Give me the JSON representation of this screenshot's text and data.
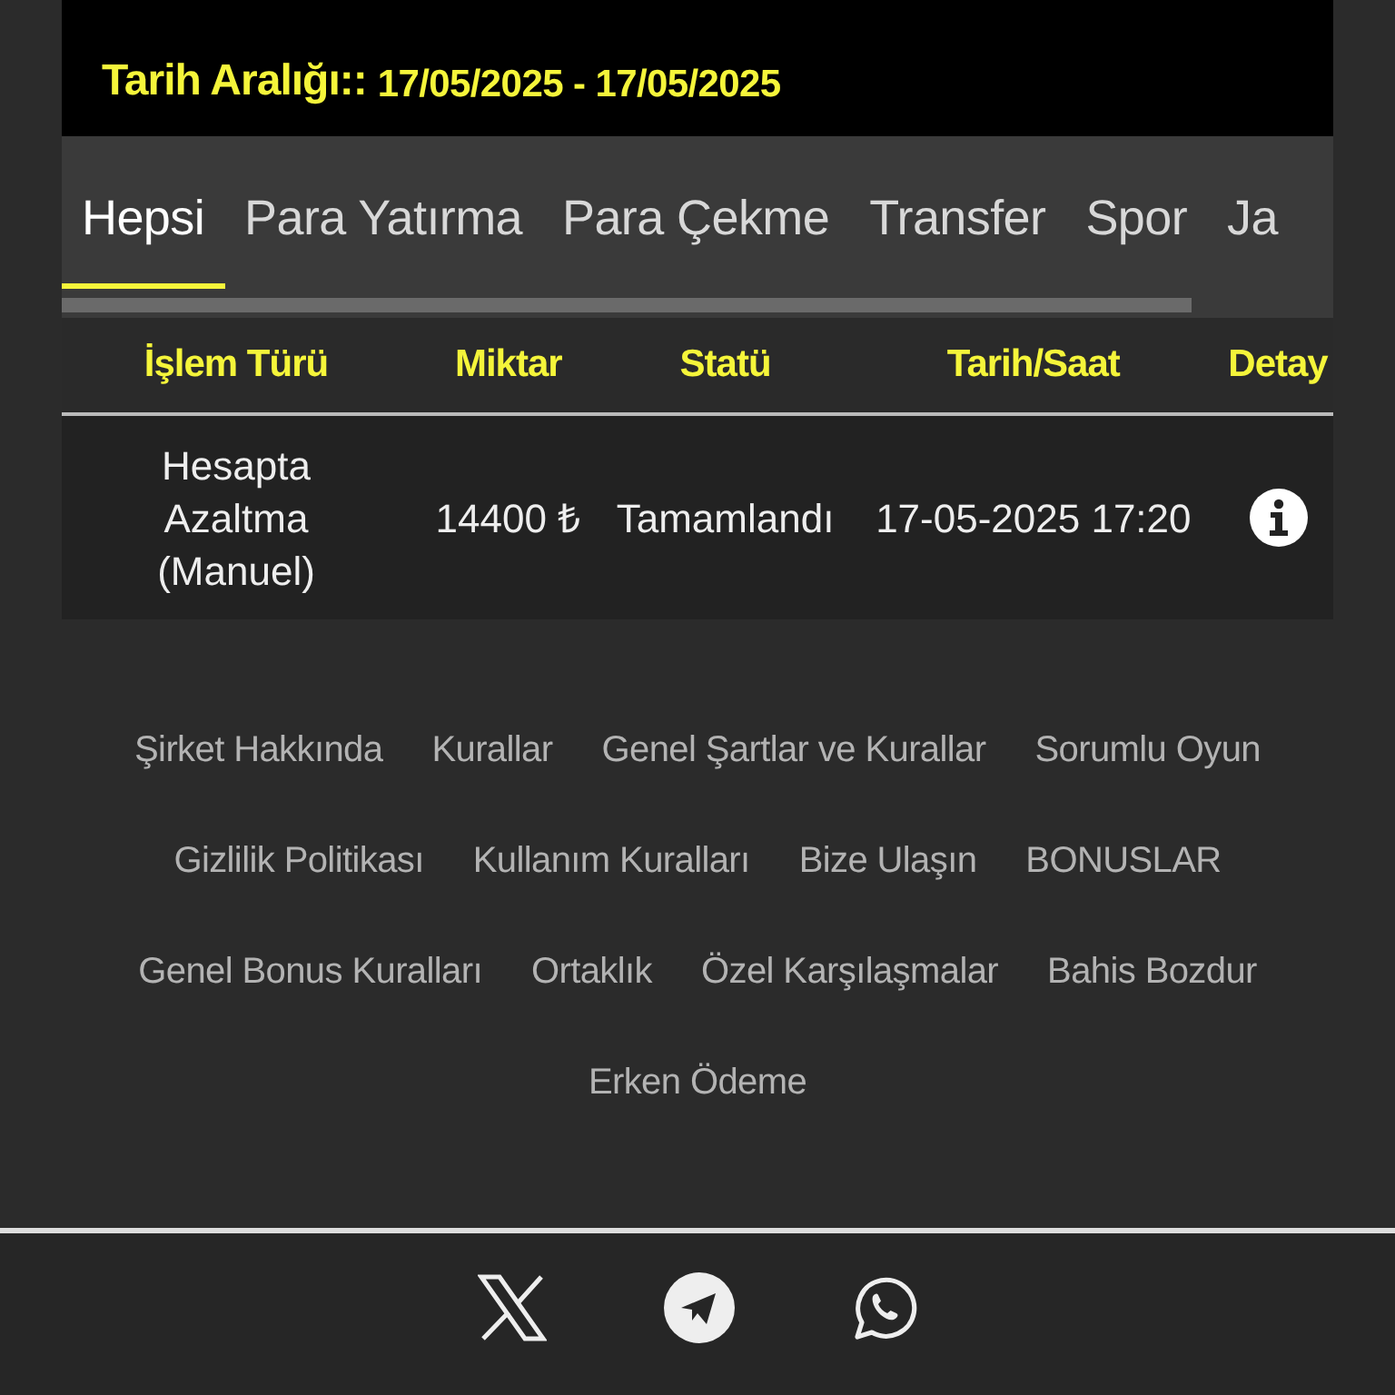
{
  "date_range": {
    "label": "Tarih Aralığı::",
    "value": "17/05/2025 - 17/05/2025"
  },
  "tabs": [
    {
      "label": "Hepsi",
      "selected": true
    },
    {
      "label": "Para Yatırma",
      "selected": false
    },
    {
      "label": "Para Çekme",
      "selected": false
    },
    {
      "label": "Transfer",
      "selected": false
    },
    {
      "label": "Spor",
      "selected": false
    },
    {
      "label": "Ja",
      "selected": false
    }
  ],
  "table": {
    "columns": [
      "İşlem Türü",
      "Miktar",
      "Statü",
      "Tarih/Saat",
      "Detay"
    ],
    "rows": [
      {
        "type": "Hesapta Azaltma (Manuel)",
        "amount": "14400 ₺",
        "status": "Tamamlandı",
        "datetime": "17-05-2025 17:20"
      }
    ]
  },
  "footer_links": [
    [
      "Şirket Hakkında",
      "Kurallar",
      "Genel Şartlar ve Kurallar",
      "Sorumlu Oyun"
    ],
    [
      "Gizlilik Politikası",
      "Kullanım Kuralları",
      "Bize Ulaşın",
      "BONUSLAR"
    ],
    [
      "Genel Bonus Kuralları",
      "Ortaklık",
      "Özel Karşılaşmalar",
      "Bahis Bozdur"
    ],
    [
      "Erken Ödeme"
    ]
  ],
  "social": [
    {
      "kind": "x"
    },
    {
      "kind": "telegram"
    },
    {
      "kind": "whatsapp"
    }
  ]
}
